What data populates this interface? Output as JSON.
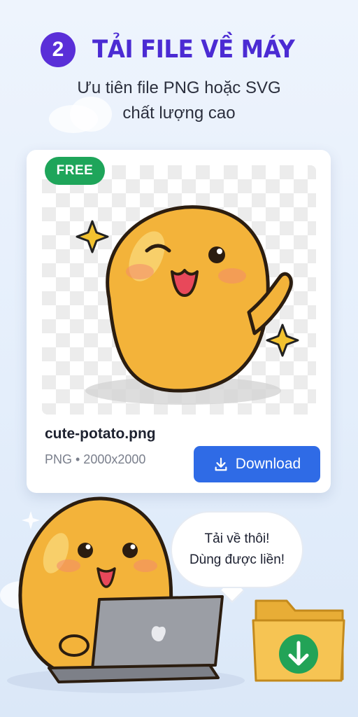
{
  "step": {
    "number": "2",
    "title": "TẢI FILE VỀ MÁY"
  },
  "subtitle": {
    "line1": "Ưu tiên file PNG hoặc SVG",
    "line2": "chất lượng cao"
  },
  "card": {
    "badge": "FREE",
    "file_name": "cute-potato.png",
    "file_meta": "PNG • 2000x2000",
    "download_label": "Download"
  },
  "bubble": {
    "line1": "Tải về thôi!",
    "line2": "Dùng được liền!"
  },
  "icons": {
    "download": "download-arrow-tray",
    "sparkle": "four-point-star",
    "folder": "folder-with-download-arrow",
    "laptop": "laptop-with-logo"
  },
  "colors": {
    "accent_purple": "#4b2bd3",
    "badge_green": "#1ea55a",
    "button_blue": "#2f6be6",
    "potato": "#f3b33a",
    "folder": "#f6c453"
  }
}
